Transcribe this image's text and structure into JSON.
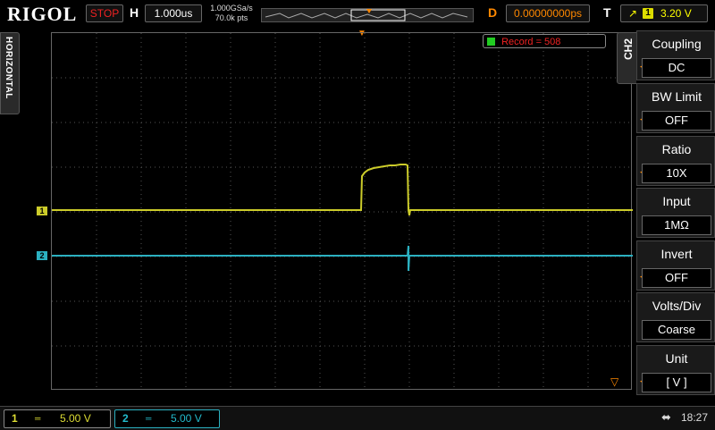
{
  "brand": "RIGOL",
  "topbar": {
    "run_state": "STOP",
    "h_label": "H",
    "timebase": "1.000us",
    "sample_rate": "1.000GSa/s",
    "mem_depth": "70.0k pts",
    "d_label": "D",
    "delay": "0.00000000ps",
    "t_label": "T",
    "trigger_source": "1",
    "trigger_level": "3.20 V"
  },
  "side_tab": "HORIZONTAL",
  "record_label": "Record = 508",
  "channel_tab": "CH2",
  "menu": [
    {
      "title": "Coupling",
      "value": "DC"
    },
    {
      "title": "BW Limit",
      "value": "OFF"
    },
    {
      "title": "Ratio",
      "value": "10X"
    },
    {
      "title": "Input",
      "value": "1MΩ"
    },
    {
      "title": "Invert",
      "value": "OFF"
    },
    {
      "title": "Volts/Div",
      "value": "Coarse"
    },
    {
      "title": "Unit",
      "value": "[ V ]"
    }
  ],
  "channels": [
    {
      "num": "1",
      "coupling": "═",
      "scale": "5.00 V",
      "color": "#cccc2a"
    },
    {
      "num": "2",
      "coupling": "═",
      "scale": "5.00 V",
      "color": "#2bb0c0"
    }
  ],
  "clock": "18:27",
  "colors": {
    "ch1": "#cccc2a",
    "ch2": "#2bb0c0",
    "trigger": "#ff8800",
    "stop": "#e22222"
  }
}
